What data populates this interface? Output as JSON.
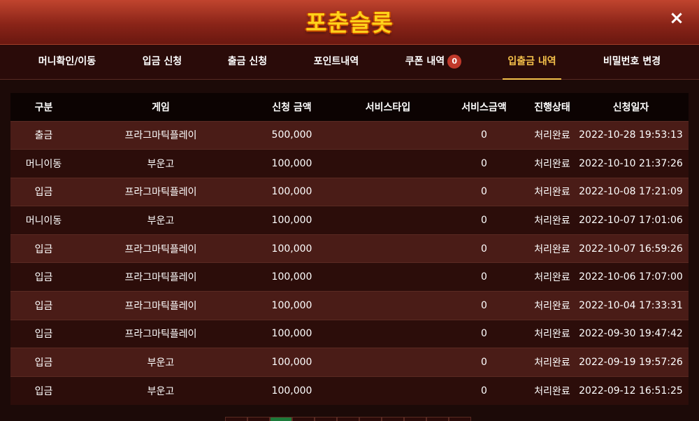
{
  "header": {
    "logo_text": "포춘슬롯",
    "close_label": "×"
  },
  "tabs": [
    {
      "label": "머니확인/이동",
      "active": false
    },
    {
      "label": "입금 신청",
      "active": false
    },
    {
      "label": "출금 신청",
      "active": false
    },
    {
      "label": "포인트내역",
      "active": false
    },
    {
      "label": "쿠폰 내역",
      "badge": "0",
      "active": false
    },
    {
      "label": "입출금 내역",
      "active": true
    },
    {
      "label": "비밀번호 변경",
      "active": false
    }
  ],
  "table": {
    "headers": [
      "구분",
      "게임",
      "신청 금액",
      "서비스타입",
      "서비스금액",
      "진행상태",
      "신청일자"
    ],
    "rows": [
      [
        "출금",
        "프라그마틱플레이",
        "500,000",
        "",
        "0",
        "처리완료",
        "2022-10-28 19:53:13"
      ],
      [
        "머니이동",
        "부운고",
        "100,000",
        "",
        "0",
        "처리완료",
        "2022-10-10 21:37:26"
      ],
      [
        "입금",
        "프라그마틱플레이",
        "100,000",
        "",
        "0",
        "처리완료",
        "2022-10-08 17:21:09"
      ],
      [
        "머니이동",
        "부운고",
        "100,000",
        "",
        "0",
        "처리완료",
        "2022-10-07 17:01:06"
      ],
      [
        "입금",
        "프라그마틱플레이",
        "100,000",
        "",
        "0",
        "처리완료",
        "2022-10-07 16:59:26"
      ],
      [
        "입금",
        "프라그마틱플레이",
        "100,000",
        "",
        "0",
        "처리완료",
        "2022-10-06 17:07:00"
      ],
      [
        "입금",
        "프라그마틱플레이",
        "100,000",
        "",
        "0",
        "처리완료",
        "2022-10-04 17:33:31"
      ],
      [
        "입금",
        "프라그마틱플레이",
        "100,000",
        "",
        "0",
        "처리완료",
        "2022-09-30 19:47:42"
      ],
      [
        "입금",
        "부운고",
        "100,000",
        "",
        "0",
        "처리완료",
        "2022-09-19 19:57:26"
      ],
      [
        "입금",
        "부운고",
        "100,000",
        "",
        "0",
        "처리완료",
        "2022-09-12 16:51:25"
      ]
    ]
  },
  "pagination": {
    "active_index": 2,
    "page_count": 11
  },
  "colors": {
    "accent": "#f4c04a",
    "header_red": "#8a2418",
    "badge": "#c0392b",
    "page_active": "#1d7a3a"
  }
}
